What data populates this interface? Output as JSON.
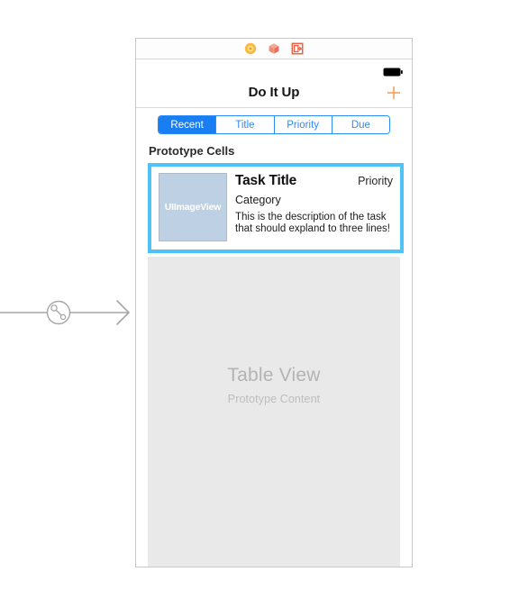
{
  "scene": {
    "dock_icons": [
      {
        "name": "view-controller-icon",
        "color": "#f5b225"
      },
      {
        "name": "first-responder-icon",
        "color": "#f07a63"
      },
      {
        "name": "exit-icon",
        "color": "#ef5f45"
      }
    ]
  },
  "segue": {
    "name": "relationship-segue-arrow",
    "badge": "relationship-segue-badge",
    "color": "#a6a6a6"
  },
  "status_bar": {
    "battery_icon": "battery-full-icon",
    "battery_color": "#000000"
  },
  "nav_bar": {
    "title": "Do It Up",
    "add_label": "+",
    "add_color": "#f5a05a"
  },
  "segmented_control": {
    "selected_index": 0,
    "accent_color": "#1a7ef3",
    "segments": [
      {
        "label": "Recent"
      },
      {
        "label": "Title"
      },
      {
        "label": "Priority"
      },
      {
        "label": "Due"
      }
    ]
  },
  "prototype_section": {
    "header": "Prototype Cells",
    "selection_color": "#4ec3f7"
  },
  "cell": {
    "image_placeholder_label": "UIImageView",
    "image_placeholder_color": "#bed0e4",
    "title": "Task Title",
    "priority": "Priority",
    "category": "Category",
    "description": "This is the description of the task that should expland to three lines!"
  },
  "table_view": {
    "title": "Table View",
    "subtitle": "Prototype Content",
    "background_color": "#e9e9e9"
  }
}
